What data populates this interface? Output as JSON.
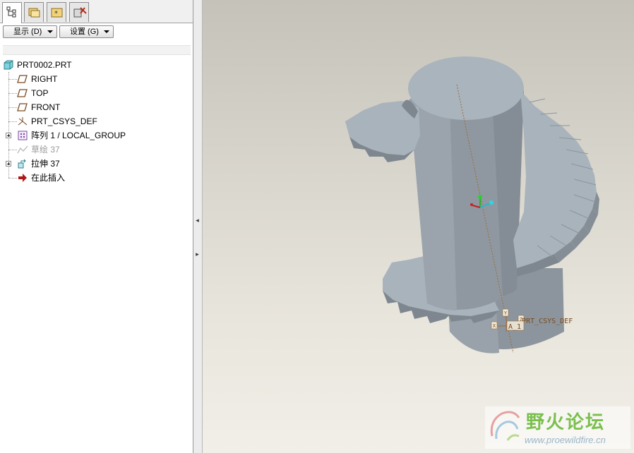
{
  "tabs": [
    {
      "name": "model-tree-tab",
      "active": true
    },
    {
      "name": "folder-browser-tab",
      "active": false
    },
    {
      "name": "favorites-tab",
      "active": false
    },
    {
      "name": "connections-tab",
      "active": false
    }
  ],
  "toolbar": {
    "show_label": "显示 (D)",
    "settings_label": "设置 (G)"
  },
  "tree": {
    "root": "PRT0002.PRT",
    "items": [
      {
        "label": "RIGHT",
        "icon": "datum-plane-icon",
        "dim": false
      },
      {
        "label": "TOP",
        "icon": "datum-plane-icon",
        "dim": false
      },
      {
        "label": "FRONT",
        "icon": "datum-plane-icon",
        "dim": false
      },
      {
        "label": "PRT_CSYS_DEF",
        "icon": "csys-icon",
        "dim": false
      },
      {
        "label": "阵列 1 / LOCAL_GROUP",
        "icon": "pattern-icon",
        "dim": false,
        "expandable": true
      },
      {
        "label": "草绘 37",
        "icon": "sketch-icon",
        "dim": true
      },
      {
        "label": "拉伸 37",
        "icon": "extrude-icon",
        "dim": false,
        "expandable": true
      },
      {
        "label": "在此插入",
        "icon": "insert-here-arrow-icon",
        "dim": false
      }
    ]
  },
  "viewport": {
    "csys_label": "PRT_CSYS_DEF",
    "axis_label": "A_1",
    "axis_label_x": "X",
    "axis_label_y": "Y",
    "axis_label_z": "Z"
  },
  "watermark": {
    "title": "野火论坛",
    "url": "www.proewildfire.cn"
  },
  "colors": {
    "model_top": "#a9b3bc",
    "model_side": "#8e979f",
    "background_top": "#c4c2b9",
    "background_bottom": "#f1efe8"
  }
}
